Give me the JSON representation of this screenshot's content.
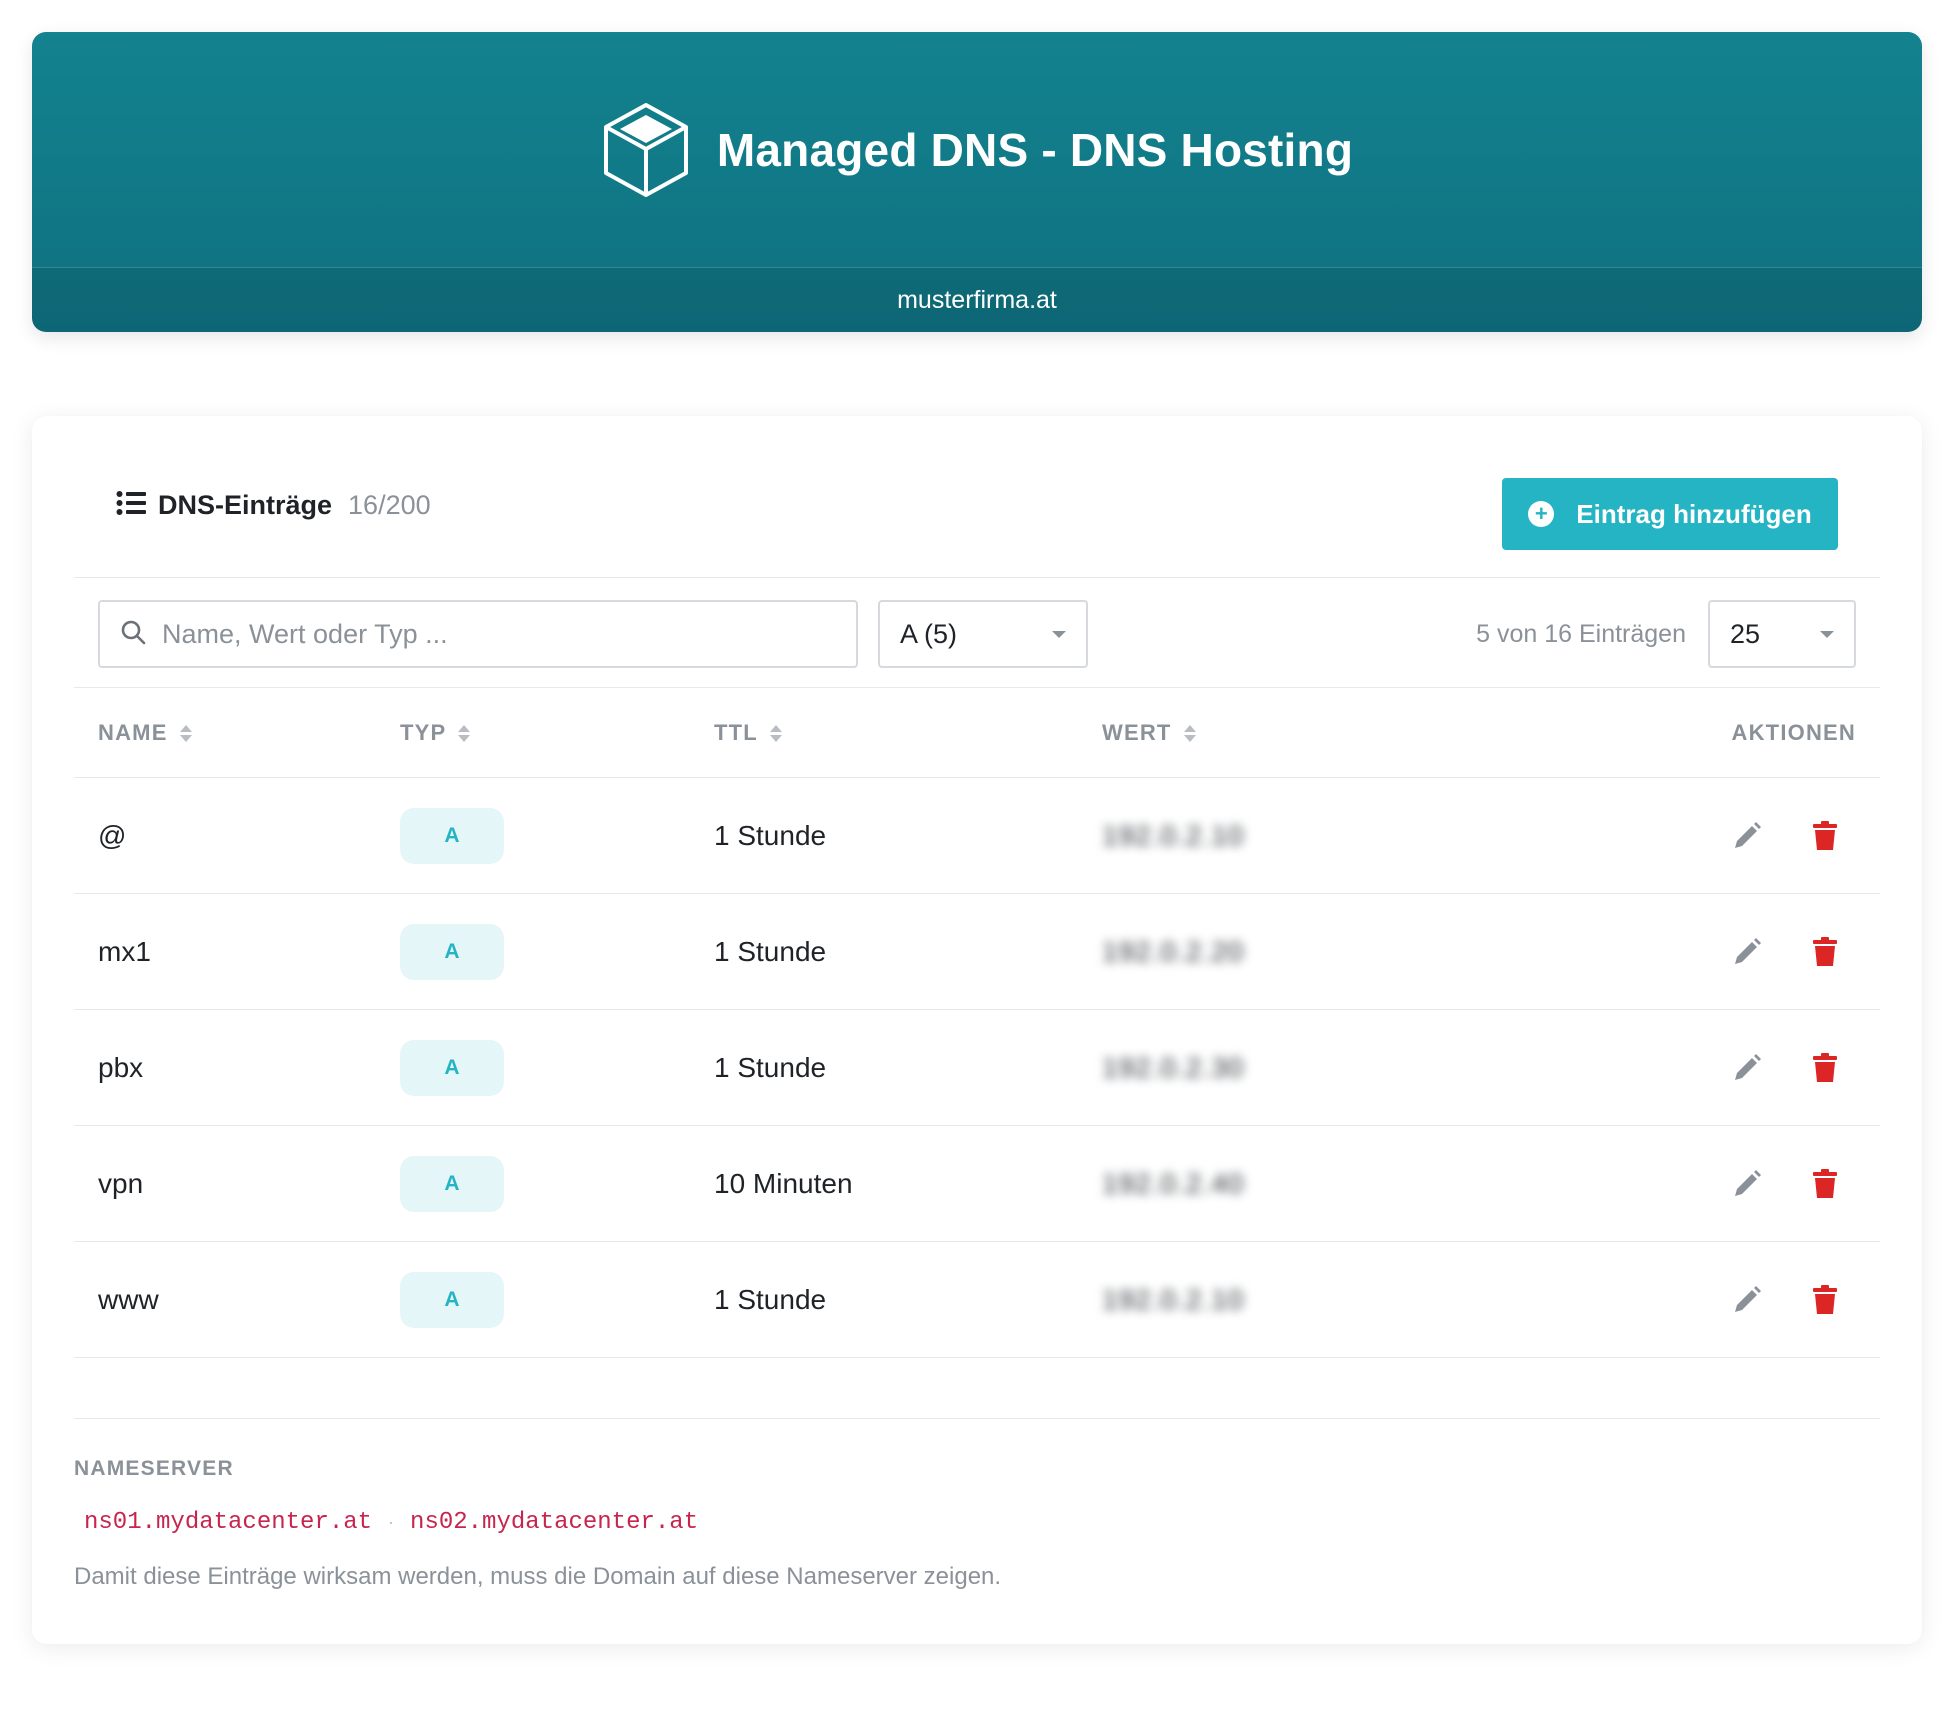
{
  "header": {
    "title": "Managed DNS - DNS Hosting",
    "domain": "musterfirma.at",
    "logo_icon": "cube-icon",
    "colors": {
      "gradient_top": "#13838f",
      "gradient_bottom": "#0f6f7f"
    }
  },
  "records": {
    "section_title": "DNS-Einträge",
    "section_icon": "list-icon",
    "count": "16/200",
    "add_button_label": "Eintrag hinzufügen",
    "add_button_icon": "plus-circle-icon",
    "accent_color": "#25b4c4"
  },
  "filters": {
    "search_placeholder": "Name, Wert oder Typ ...",
    "search_value": "",
    "type_filter_value": "A (5)",
    "entries_info": "5 von 16 Einträgen",
    "per_page_value": "25"
  },
  "table": {
    "columns": [
      "NAME",
      "TYP",
      "TTL",
      "WERT",
      "AKTIONEN"
    ],
    "rows": [
      {
        "name": "@",
        "type": "A",
        "ttl": "1 Stunde",
        "value": "192.0.2.10"
      },
      {
        "name": "mx1",
        "type": "A",
        "ttl": "1 Stunde",
        "value": "192.0.2.20"
      },
      {
        "name": "pbx",
        "type": "A",
        "ttl": "1 Stunde",
        "value": "192.0.2.30"
      },
      {
        "name": "vpn",
        "type": "A",
        "ttl": "10 Minuten",
        "value": "192.0.2.40"
      },
      {
        "name": "www",
        "type": "A",
        "ttl": "1 Stunde",
        "value": "192.0.2.10"
      }
    ],
    "edit_icon": "pencil-icon",
    "delete_icon": "trash-icon",
    "delete_color": "#dc2626"
  },
  "nameserver": {
    "label": "NAMESERVER",
    "servers": [
      "ns01.mydatacenter.at",
      "ns02.mydatacenter.at"
    ],
    "separator": "·",
    "note": "Damit diese Einträge wirksam werden, muss die Domain auf diese Nameserver zeigen."
  }
}
